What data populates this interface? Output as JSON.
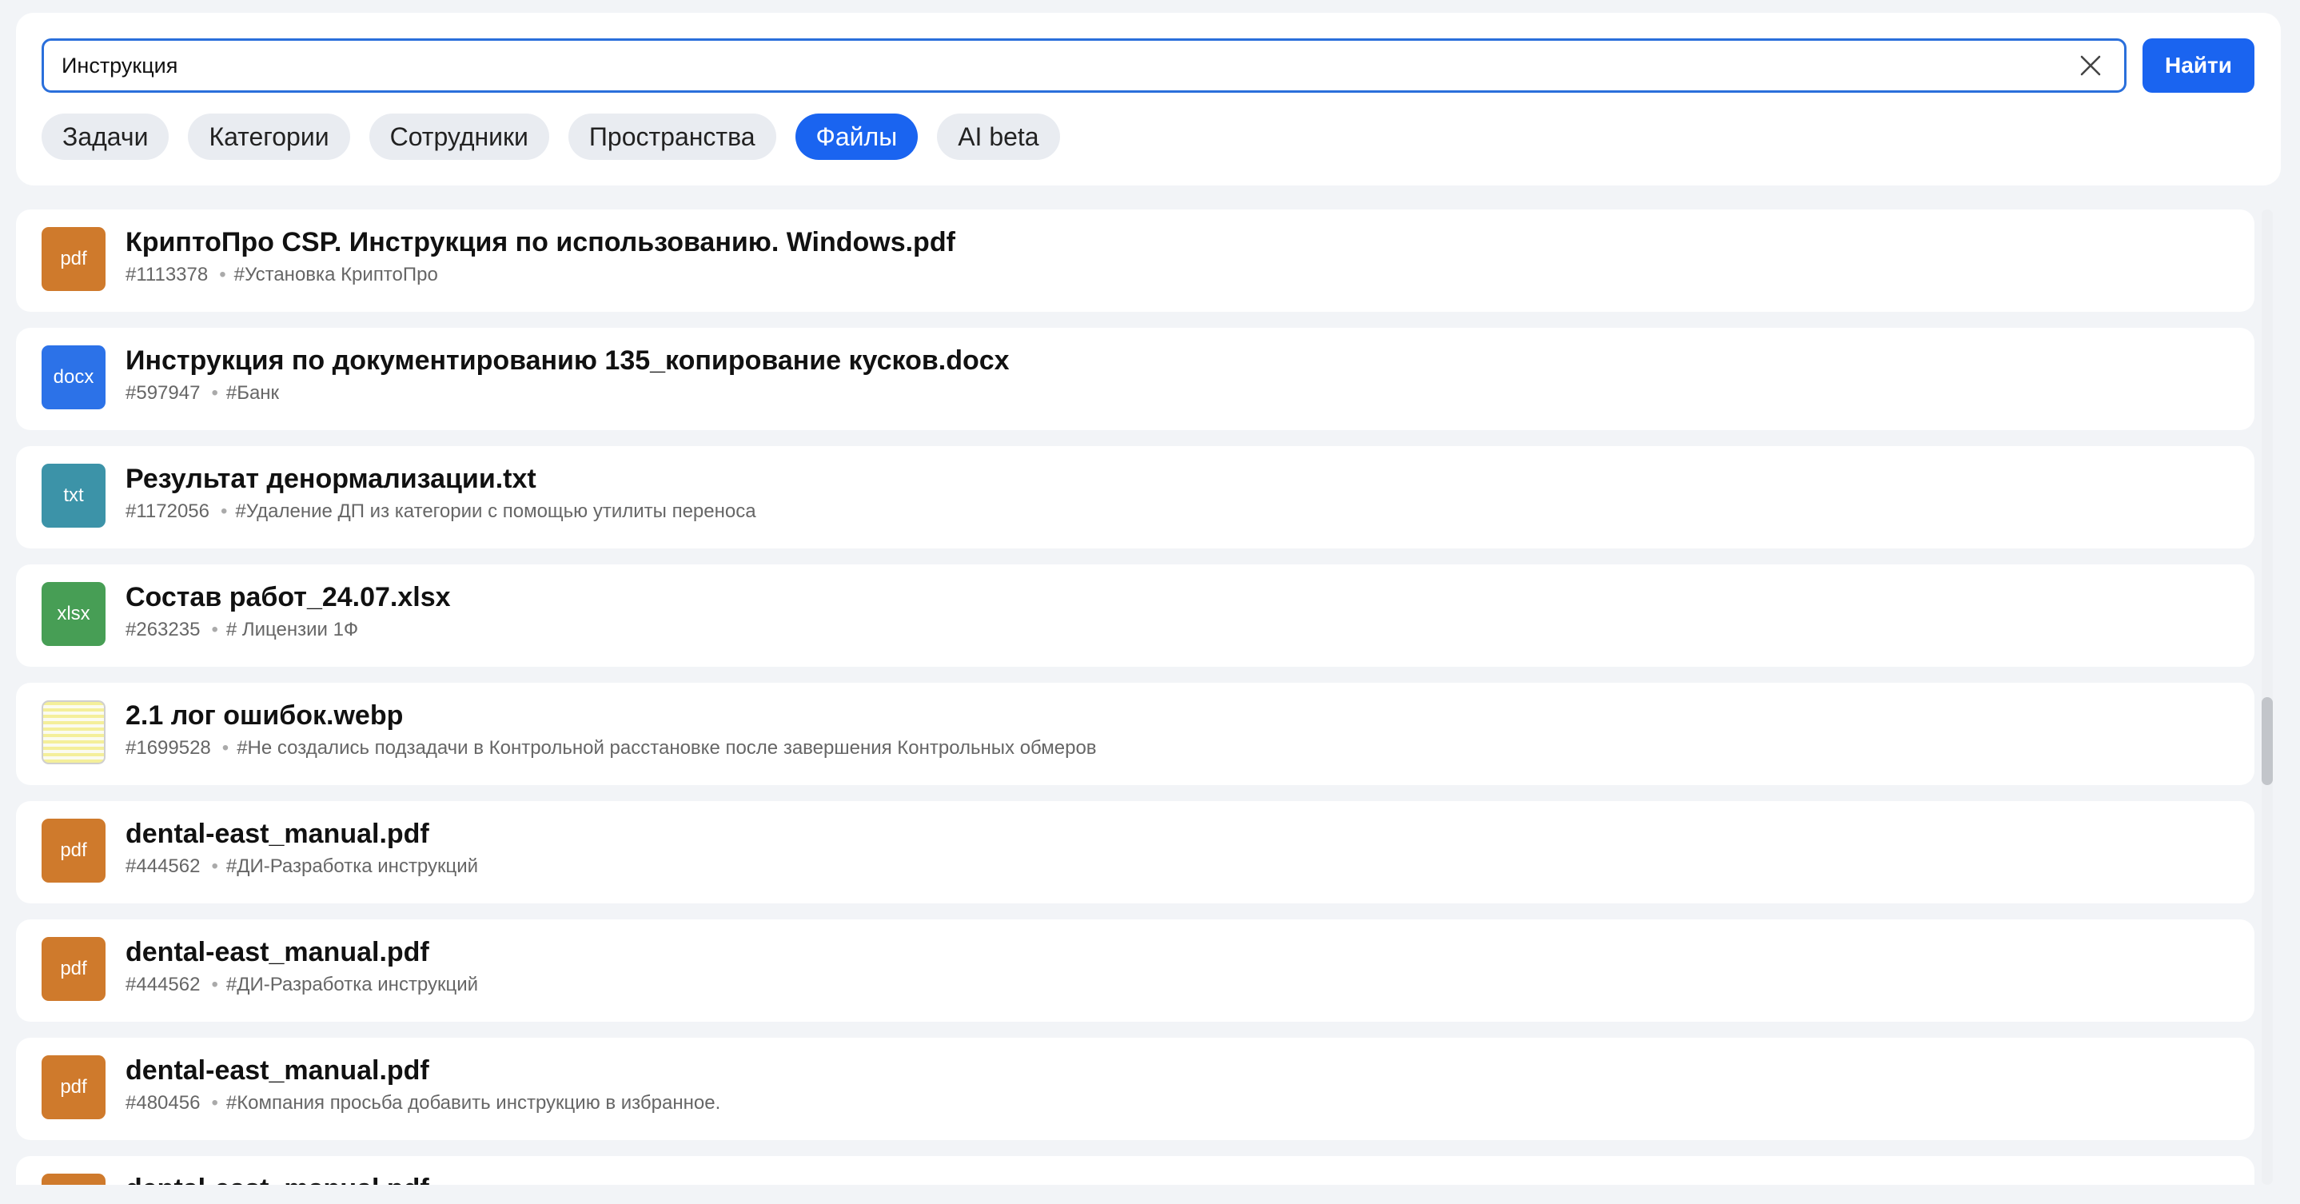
{
  "search": {
    "value": "Инструкция",
    "button_label": "Найти"
  },
  "tabs": [
    {
      "label": "Задачи",
      "active": false
    },
    {
      "label": "Категории",
      "active": false
    },
    {
      "label": "Сотрудники",
      "active": false
    },
    {
      "label": "Пространства",
      "active": false
    },
    {
      "label": "Файлы",
      "active": true
    },
    {
      "label": "AI beta",
      "active": false
    }
  ],
  "results": [
    {
      "type": "pdf",
      "title": "КриптоПро CSP. Инструкция по использованию. Windows.pdf",
      "id": "#1113378",
      "tag": "#Установка КриптоПро"
    },
    {
      "type": "docx",
      "title": "Инструкция по документированию 135_копирование кусков.docx",
      "id": "#597947",
      "tag": "#Банк"
    },
    {
      "type": "txt",
      "title": "Результат денормализации.txt",
      "id": "#1172056",
      "tag": "#Удаление ДП из категории с помощью утилиты переноса"
    },
    {
      "type": "xlsx",
      "title": "Состав работ_24.07.xlsx",
      "id": "#263235",
      "tag": "# Лицензии 1Ф"
    },
    {
      "type": "",
      "title": "2.1 лог ошибок.webp",
      "id": "#1699528",
      "tag": "#Не создались подзадачи в Контрольной расстановке после завершения Контрольных обмеров"
    },
    {
      "type": "pdf",
      "title": "dental-east_manual.pdf",
      "id": "#444562",
      "tag": "#ДИ-Разработка инструкций"
    },
    {
      "type": "pdf",
      "title": "dental-east_manual.pdf",
      "id": "#444562",
      "tag": "#ДИ-Разработка инструкций"
    },
    {
      "type": "pdf",
      "title": "dental-east_manual.pdf",
      "id": "#480456",
      "tag": "#Компания просьба добавить инструкцию в избранное."
    },
    {
      "type": "pdf",
      "title": "dental-east_manual.pdf",
      "id": "",
      "tag": ""
    }
  ],
  "colors": {
    "pdf": "#cf7a2c",
    "docx": "#2c72e8",
    "txt": "#3c93a8",
    "xlsx": "#479e55",
    "accent": "#1a64f0"
  },
  "meta_separator": "•"
}
